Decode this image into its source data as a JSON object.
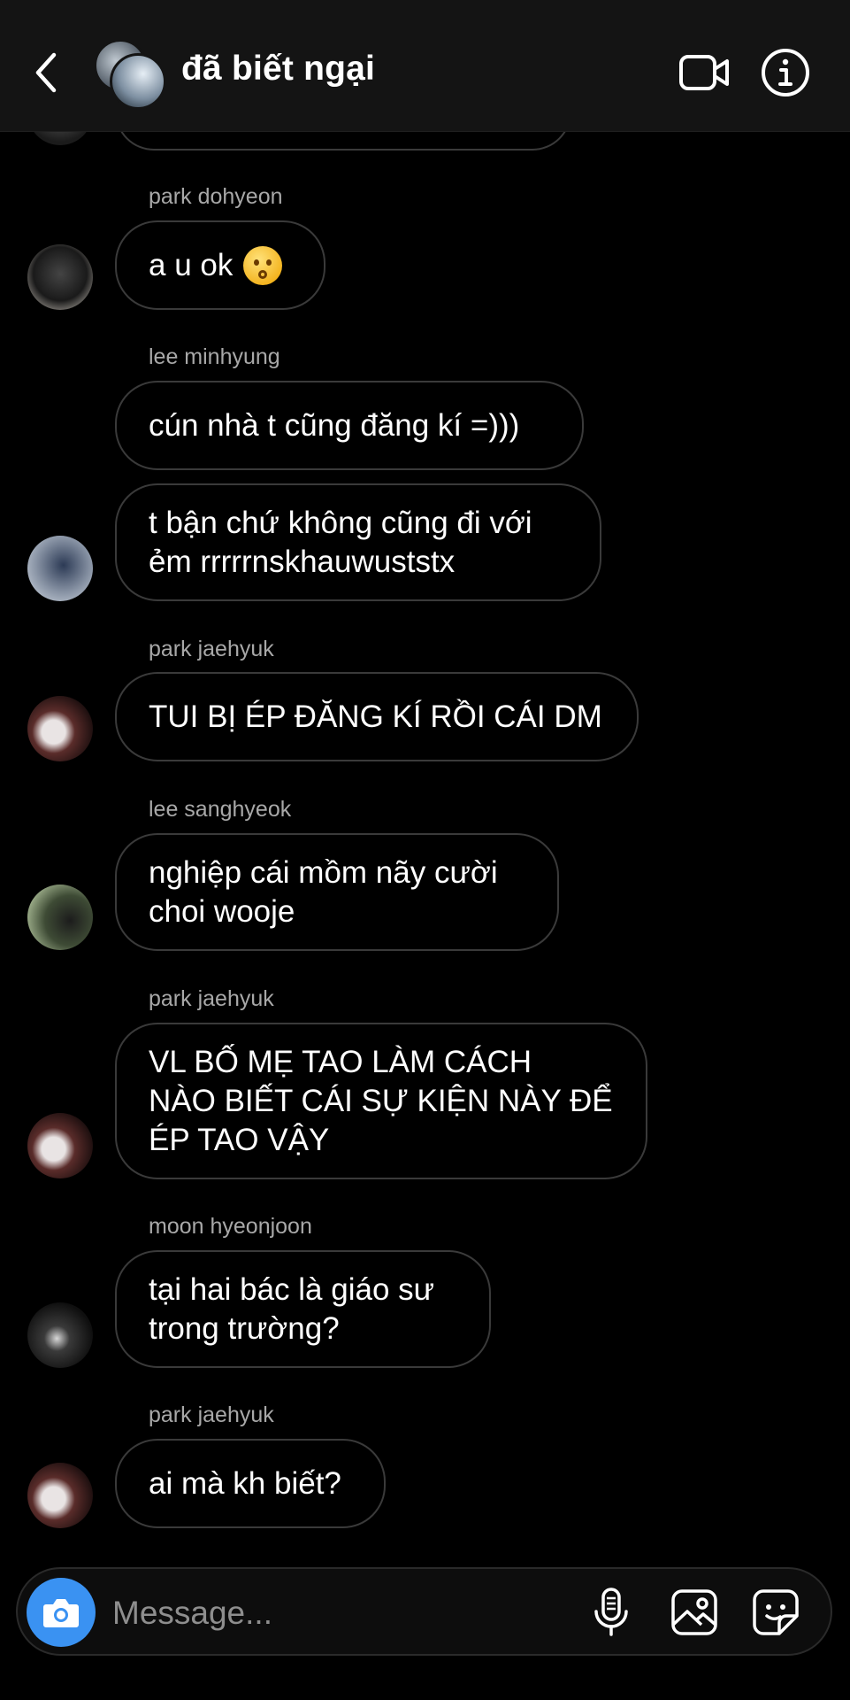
{
  "header": {
    "title": "đã biết ngại",
    "back_icon": "chevron-left-icon",
    "video_icon": "video-call-icon",
    "info_icon": "info-icon"
  },
  "messages": [
    {
      "sender": "park dohyeon",
      "lines": "a u ok",
      "emoji": "anxious-face-emoji"
    },
    {
      "sender": "lee minhyung",
      "lines": "cún nhà t cũng đăng kí =)))"
    },
    {
      "sender": "",
      "lines": "t bận chứ không cũng đi với\nẻm rrrrrnskhauwuststx"
    },
    {
      "sender": "park jaehyuk",
      "lines": "TUI BỊ ÉP ĐĂNG KÍ RỒI CÁI DM"
    },
    {
      "sender": "lee sanghyeok",
      "lines": "nghiệp cái mồm nãy cười\nchoi wooje"
    },
    {
      "sender": "park jaehyuk",
      "lines": "VL BỐ MẸ TAO LÀM CÁCH\nNÀO BIẾT CÁI SỰ KIỆN NÀY ĐỂ\nÉP TAO VẬY"
    },
    {
      "sender": "moon hyeonjoon",
      "lines": "tại hai bác là giáo sư\ntrong trường?"
    },
    {
      "sender": "park jaehyuk",
      "lines": "ai mà kh biết?"
    }
  ],
  "composer": {
    "placeholder": "Message...",
    "camera_icon": "camera-icon",
    "mic_icon": "microphone-icon",
    "gallery_icon": "gallery-icon",
    "sticker_icon": "sticker-icon",
    "accent": "#3a92f2"
  }
}
